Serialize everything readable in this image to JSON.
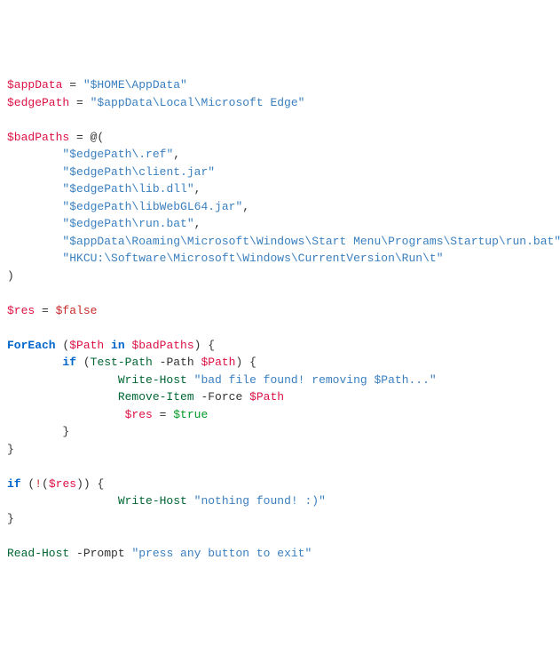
{
  "code": {
    "line1_var": "$appData",
    "line1_eq": " = ",
    "line1_str": "\"$HOME\\AppData\"",
    "line2_var": "$edgePath",
    "line2_eq": " = ",
    "line2_str": "\"$appData\\Local\\Microsoft Edge\"",
    "line4_var": "$badPaths",
    "line4_eq": " = @(",
    "line5_indent": "        ",
    "line5_str": "\"$edgePath\\.ref\"",
    "line5_comma": ",",
    "line6_str": "\"$edgePath\\client.jar\"",
    "line7_str": "\"$edgePath\\lib.dll\"",
    "line7_comma": ",",
    "line8_str": "\"$edgePath\\libWebGL64.jar\"",
    "line8_comma": ",",
    "line9_str": "\"$edgePath\\run.bat\"",
    "line9_comma": ",",
    "line10_str": "\"$appData\\Roaming\\Microsoft\\Windows\\Start Menu\\Programs\\Startup\\run.bat\"",
    "line10_comma": ",",
    "line11_str": "\"HKCU:\\Software\\Microsoft\\Windows\\CurrentVersion\\Run\\t\"",
    "line12_close": ")",
    "line14_var": "$res",
    "line14_eq": " = ",
    "line14_val": "$false",
    "line16_kw": "ForEach",
    "line16_open": " (",
    "line16_var1": "$Path",
    "line16_in": " in ",
    "line16_var2": "$badPaths",
    "line16_close": ") {",
    "line17_indent": "        ",
    "line17_kw": "if",
    "line17_open": " (",
    "line17_cmd": "Test-Path",
    "line17_param": " -Path ",
    "line17_var": "$Path",
    "line17_close": ") {",
    "line18_indent": "                ",
    "line18_cmd": "Write-Host",
    "line18_sp": " ",
    "line18_str": "\"bad file found! removing $Path...\"",
    "line19_cmd": "Remove-Item",
    "line19_param": " -Force ",
    "line19_var": "$Path",
    "line20_indent": "                 ",
    "line20_var": "$res",
    "line20_eq": " = ",
    "line20_val": "$true",
    "line21_indent": "        ",
    "line21_close": "}",
    "line22_close": "}",
    "line24_kw": "if",
    "line24_open": " (",
    "line24_not": "!",
    "line24_paren": "(",
    "line24_var": "$res",
    "line24_closep": ")) {",
    "line25_indent": "                ",
    "line25_cmd": "Write-Host",
    "line25_sp": " ",
    "line25_str": "\"nothing found! :)\"",
    "line26_close": "}",
    "line28_cmd": "Read-Host",
    "line28_param": " -Prompt ",
    "line28_str": "\"press any button to exit\""
  }
}
